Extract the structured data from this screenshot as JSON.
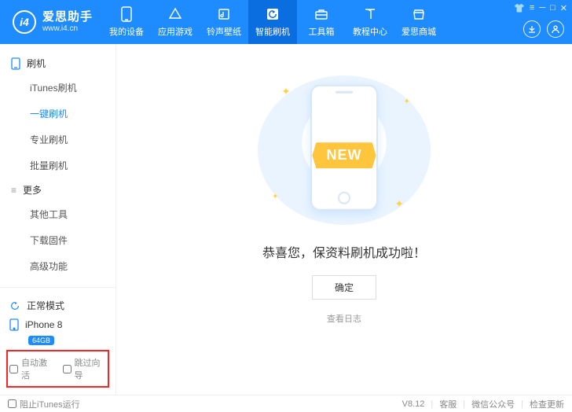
{
  "brand": {
    "cn": "爱思助手",
    "url": "www.i4.cn",
    "badge": "i4"
  },
  "topnav": [
    {
      "label": "我的设备"
    },
    {
      "label": "应用游戏"
    },
    {
      "label": "铃声壁纸"
    },
    {
      "label": "智能刷机"
    },
    {
      "label": "工具箱"
    },
    {
      "label": "教程中心"
    },
    {
      "label": "爱思商城"
    }
  ],
  "sidebar": {
    "group1": "刷机",
    "items1": [
      "iTunes刷机",
      "一键刷机",
      "专业刷机",
      "批量刷机"
    ],
    "group2": "更多",
    "items2": [
      "其他工具",
      "下载固件",
      "高级功能"
    ]
  },
  "status": {
    "mode": "正常模式",
    "device": "iPhone 8",
    "storage": "64GB"
  },
  "checks": {
    "auto_activate": "自动激活",
    "skip_guide": "跳过向导"
  },
  "main": {
    "ribbon": "NEW",
    "msg": "恭喜您，保资料刷机成功啦！",
    "ok": "确定",
    "log": "查看日志"
  },
  "footer": {
    "block_itunes": "阻止iTunes运行",
    "version": "V8.12",
    "support": "客服",
    "wechat": "微信公众号",
    "update": "检查更新"
  }
}
